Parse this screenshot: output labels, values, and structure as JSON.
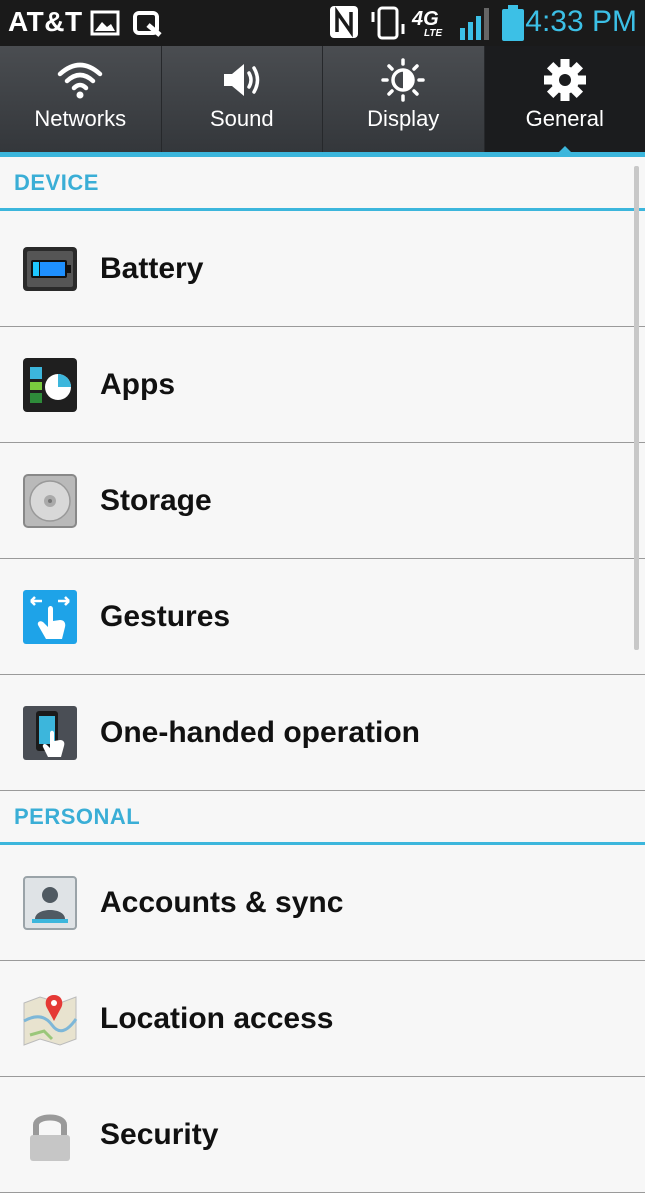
{
  "status_bar": {
    "carrier": "AT&T",
    "network": "4G",
    "network_sub": "LTE",
    "time": "4:33 PM",
    "left_icons": [
      "gallery-icon",
      "q-slide-icon"
    ],
    "right_icons": [
      "nfc-icon",
      "vibrate-icon",
      "4g-lte-icon",
      "signal-icon",
      "battery-icon"
    ]
  },
  "tabs": [
    {
      "label": "Networks",
      "icon": "wifi-icon",
      "active": false
    },
    {
      "label": "Sound",
      "icon": "speaker-icon",
      "active": false
    },
    {
      "label": "Display",
      "icon": "brightness-icon",
      "active": false
    },
    {
      "label": "General",
      "icon": "gear-icon",
      "active": true
    }
  ],
  "sections": [
    {
      "header": "DEVICE",
      "items": [
        {
          "label": "Battery",
          "icon": "battery-icon"
        },
        {
          "label": "Apps",
          "icon": "apps-icon"
        },
        {
          "label": "Storage",
          "icon": "storage-icon"
        },
        {
          "label": "Gestures",
          "icon": "gestures-icon"
        },
        {
          "label": "One-handed operation",
          "icon": "one-handed-icon"
        }
      ]
    },
    {
      "header": "PERSONAL",
      "items": [
        {
          "label": "Accounts & sync",
          "icon": "accounts-icon"
        },
        {
          "label": "Location access",
          "icon": "location-icon"
        },
        {
          "label": "Security",
          "icon": "lock-icon"
        }
      ]
    }
  ],
  "colors": {
    "accent": "#3cb6dc",
    "time": "#3cc0e6",
    "tab_bg": "#3a3d40",
    "active_tab_bg": "#1b1c1e"
  }
}
